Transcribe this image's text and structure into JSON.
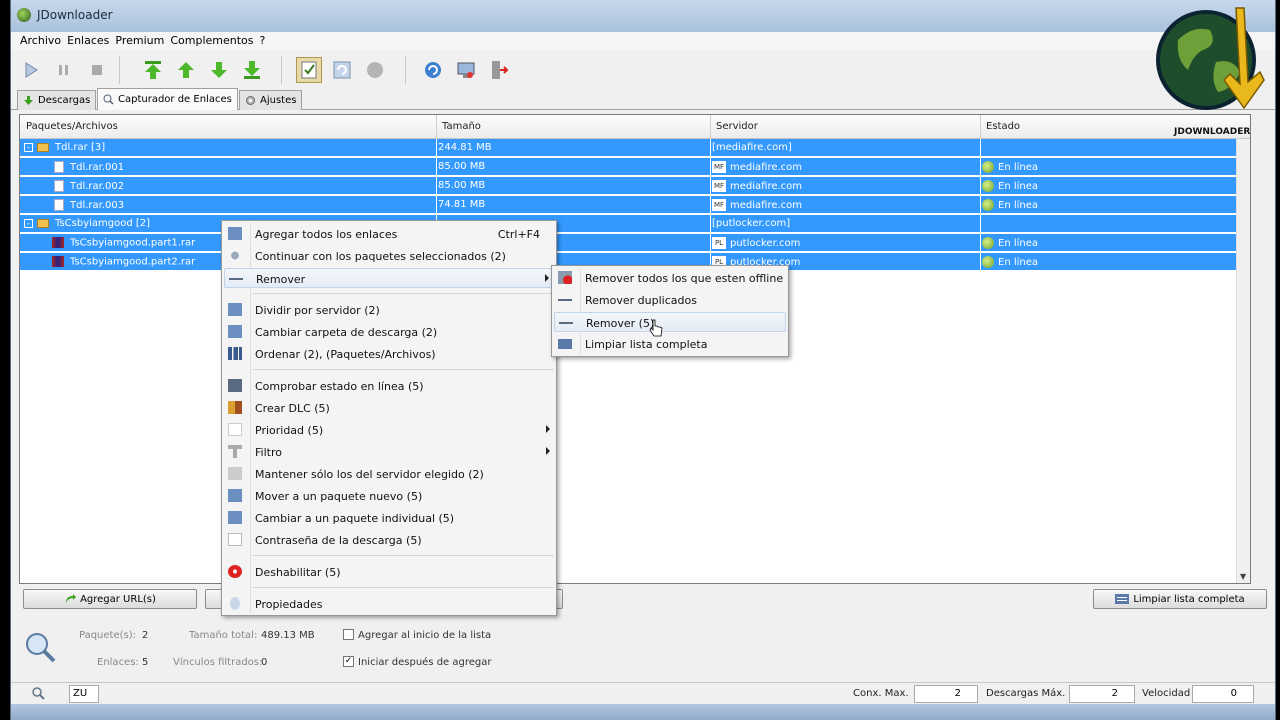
{
  "window": {
    "title": "JDownloader"
  },
  "menu": [
    "Archivo",
    "Enlaces",
    "Premium",
    "Complementos",
    "?"
  ],
  "toolbar": {
    "buttons": [
      "play-icon",
      "pause-icon",
      "stop-icon",
      "move-top-icon",
      "move-up-icon",
      "move-down-icon",
      "move-bottom-icon",
      "clipboard-monitor-icon",
      "reconnect-toggle-icon",
      "premium-toggle-icon",
      "refresh-icon",
      "reconnect-icon",
      "exit-icon"
    ]
  },
  "tabs": [
    {
      "label": "Descargas",
      "icon": "download-arrow-icon"
    },
    {
      "label": "Capturador de Enlaces",
      "icon": "linkgrabber-icon"
    },
    {
      "label": "Ajustes",
      "icon": "settings-gear-icon"
    }
  ],
  "grid": {
    "columns": [
      "Paquetes/Archivos",
      "Tamaño",
      "Servidor",
      "Estado"
    ],
    "rows": [
      {
        "type": "package",
        "name": "Tdl.rar [3]",
        "size": "244.81 MB",
        "host": "[mediafire.com]",
        "status": ""
      },
      {
        "type": "file",
        "name": "Tdl.rar.001",
        "size": "85.00 MB",
        "host": "mediafire.com",
        "host_icon": "MF",
        "status": "En línea"
      },
      {
        "type": "file",
        "name": "Tdl.rar.002",
        "size": "85.00 MB",
        "host": "mediafire.com",
        "host_icon": "MF",
        "status": "En línea"
      },
      {
        "type": "file",
        "name": "Tdl.rar.003",
        "size": "74.81 MB",
        "host": "mediafire.com",
        "host_icon": "MF",
        "status": "En línea"
      },
      {
        "type": "package",
        "name": "TsCsbyiamgood [2]",
        "size": "",
        "host": "[putlocker.com]",
        "status": ""
      },
      {
        "type": "rar",
        "name": "TsCsbyiamgood.part1.rar",
        "size": "",
        "host": "putlocker.com",
        "host_icon": "PL",
        "status": "En línea"
      },
      {
        "type": "rar",
        "name": "TsCsbyiamgood.part2.rar",
        "size": "",
        "host": "putlocker.com",
        "host_icon": "PL",
        "status": "En línea"
      }
    ]
  },
  "buttons": {
    "add_urls": "Agregar URL(s)",
    "clear_list": "Limpiar lista completa"
  },
  "summary": {
    "packages_label": "Paquete(s):",
    "packages_value": "2",
    "size_label": "Tamaño total:",
    "size_value": "489.13 MB",
    "links_label": "Enlaces:",
    "links_value": "5",
    "filtered_label": "Vínculos filtrados:",
    "filtered_value": "0",
    "add_top_label": "Agregar al inicio de la lista",
    "add_top_checked": false,
    "start_after_label": "Iniciar después de agregar",
    "start_after_checked": true
  },
  "statusbar": {
    "zoom_field": "ZU",
    "max_conn_label": "Conx. Max.",
    "max_conn_value": "2",
    "max_dl_label": "Descargas Máx.",
    "max_dl_value": "2",
    "speed_label": "Velocidad",
    "speed_value": "0"
  },
  "context_menu": [
    {
      "label": "Agregar todos los enlaces",
      "shortcut": "Ctrl+F4",
      "icon": "add-all-icon"
    },
    {
      "label": "Continuar con los paquetes seleccionados (2)",
      "icon": "continue-icon"
    },
    {
      "label": "Remover",
      "icon": "remove-icon",
      "submenu": true,
      "highlight": true
    },
    {
      "separator": true
    },
    {
      "label": "Dividir por servidor (2)",
      "icon": "folder-icon"
    },
    {
      "label": "Cambiar carpeta de descarga (2)",
      "icon": "folder-icon"
    },
    {
      "label": "Ordenar (2), (Paquetes/Archivos)",
      "icon": "sort-icon"
    },
    {
      "separator": true
    },
    {
      "label": "Comprobar estado en línea (5)",
      "icon": "check-online-icon"
    },
    {
      "label": "Crear DLC (5)",
      "icon": "dlc-icon"
    },
    {
      "label": "Prioridad (5)",
      "icon": "priority-icon",
      "submenu": true
    },
    {
      "label": "Filtro",
      "icon": "filter-icon",
      "submenu": true
    },
    {
      "label": "Mantener sólo los del servidor elegido (2)",
      "icon": "keep-host-icon"
    },
    {
      "label": "Mover a un paquete nuevo (5)",
      "icon": "folder-icon"
    },
    {
      "label": "Cambiar a un paquete individual (5)",
      "icon": "folder-icon"
    },
    {
      "label": "Contraseña de la descarga (5)",
      "icon": "password-icon"
    },
    {
      "separator": true
    },
    {
      "label": "Deshabilitar (5)",
      "icon": "disable-icon"
    },
    {
      "separator": true
    },
    {
      "label": "Propiedades",
      "icon": "properties-icon"
    }
  ],
  "submenu": [
    {
      "label": "Remover todos los que esten offline",
      "icon": "remove-offline-icon"
    },
    {
      "label": "Remover duplicados",
      "icon": "remove-icon"
    },
    {
      "label": "Remover (5)",
      "icon": "remove-icon",
      "highlight": true
    },
    {
      "label": "Limpiar lista completa",
      "icon": "clear-list-icon"
    }
  ],
  "logo_text": "JDOWNLOADER",
  "colors": {
    "selection": "#3399ff",
    "menu_bg": "#f4f4f4",
    "accent_green": "#3a9a1e"
  }
}
